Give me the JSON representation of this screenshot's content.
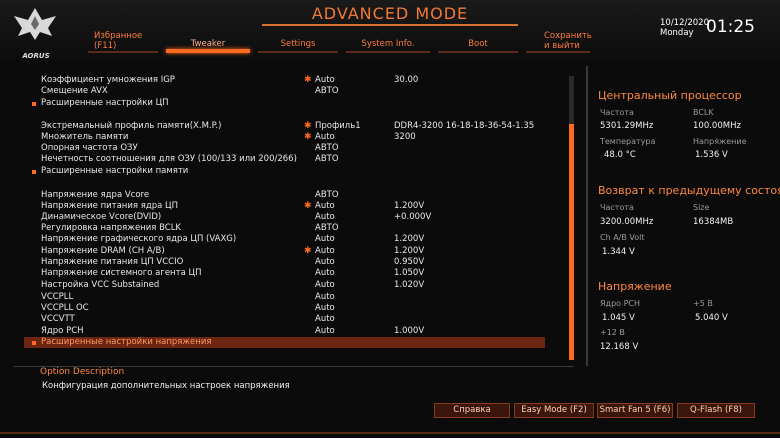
{
  "header": {
    "mode_title": "ADVANCED MODE",
    "logo_text": "AORUS",
    "date": "10/12/2020",
    "day": "Monday",
    "time": "01:25",
    "tabs": [
      {
        "label_line1": "Избранное",
        "label_line2": "(F11)"
      },
      {
        "label_line1": "",
        "label_line2": "Tweaker"
      },
      {
        "label_line1": "",
        "label_line2": "Settings"
      },
      {
        "label_line1": "",
        "label_line2": "System Info."
      },
      {
        "label_line1": "",
        "label_line2": "Boot"
      },
      {
        "label_line1": "Сохранить",
        "label_line2": "и выйти"
      }
    ]
  },
  "settings": [
    {
      "label": "Коэффициент умножения IGP",
      "star": "✱",
      "value": "Auto",
      "value2": "30.00"
    },
    {
      "label": "Смещение AVX",
      "star": "",
      "value": "АВТО",
      "value2": ""
    },
    {
      "label": "Расширенные настройки ЦП",
      "sub": true
    },
    {
      "label": "Экстремальный профиль памяти(X.M.P.)",
      "star": "✱",
      "value": "Профиль1",
      "value2": "DDR4-3200 16-18-18-36-54-1.35"
    },
    {
      "label": "Множитель памяти",
      "star": "✱",
      "value": "Auto",
      "value2": "3200"
    },
    {
      "label": "Опорная частота ОЗУ",
      "star": "",
      "value": "АВТО",
      "value2": ""
    },
    {
      "label": "Нечетность соотношения для ОЗУ (100/133 или 200/266)",
      "star": "",
      "value": "АВТО",
      "value2": ""
    },
    {
      "label": "Расширенные настройки памяти",
      "sub": true
    },
    {
      "label": "Напряжение ядра Vcore",
      "star": "",
      "value": "АВТО",
      "value2": ""
    },
    {
      "label": "Напряжение питания ядра ЦП",
      "star": "✱",
      "value": "Auto",
      "value2": "1.200V"
    },
    {
      "label": "Динамическое Vcore(DVID)",
      "star": "",
      "value": "Auto",
      "value2": "+0.000V"
    },
    {
      "label": "Регулировка напряжения BCLK",
      "star": "",
      "value": "АВТО",
      "value2": ""
    },
    {
      "label": "Напряжение графического ядра ЦП (VAXG)",
      "star": "",
      "value": "Auto",
      "value2": "1.200V"
    },
    {
      "label": "Напряжение DRAM     (CH A/B)",
      "star": "✱",
      "value": "Auto",
      "value2": "1.200V"
    },
    {
      "label": "Напряжение питания ЦП VCCIO",
      "star": "",
      "value": "Auto",
      "value2": "0.950V"
    },
    {
      "label": "Напряжение системного агента ЦП",
      "star": "",
      "value": "Auto",
      "value2": "1.050V"
    },
    {
      "label": "Настройка VCC Substained",
      "star": "",
      "value": "Auto",
      "value2": "1.020V"
    },
    {
      "label": "VCCPLL",
      "star": "",
      "value": "Auto",
      "value2": ""
    },
    {
      "label": "VCCPLL OC",
      "star": "",
      "value": "Auto",
      "value2": ""
    },
    {
      "label": "VCCVTT",
      "star": "",
      "value": "Auto",
      "value2": ""
    },
    {
      "label": "Ядро PCH",
      "star": "",
      "value": "Auto",
      "value2": "1.000V"
    },
    {
      "label": "Расширенные настройки напряжения",
      "sub": true,
      "selected": true
    }
  ],
  "option": {
    "title": "Option Description",
    "description": "Конфигурация дополнительных настроек напряжения"
  },
  "side": {
    "cpu": {
      "heading": "Центральный процессор",
      "freq_label": "Частота",
      "freq_value": "5301.29MHz",
      "bclk_label": "BCLK",
      "bclk_value": "100.00MHz",
      "temp_label": "Температура",
      "temp_value": "48.0 °C",
      "volt_label": "Напряжение",
      "volt_value": "1.536 V"
    },
    "memory": {
      "heading": "Возврат к предыдущему состоя",
      "freq_label": "Частота",
      "freq_value": "3200.00MHz",
      "size_label": "Size",
      "size_value": "16384MB",
      "volt_label": "Ch A/B Volt",
      "volt_value": "1.344 V"
    },
    "voltage": {
      "heading": "Напряжение",
      "pch_label": "Ядро PCH",
      "pch_value": "1.045 V",
      "v5_label": "+5 В",
      "v5_value": "5.040 V",
      "v12_label": "+12 В",
      "v12_value": "12.168 V"
    }
  },
  "footer": {
    "help": "Справка",
    "easy": "Easy Mode (F2)",
    "fan": "Smart Fan 5 (F6)",
    "qflash": "Q-Flash (F8)"
  },
  "colors": {
    "accent": "#ff6a20",
    "selected_bg": "#6b2510"
  }
}
